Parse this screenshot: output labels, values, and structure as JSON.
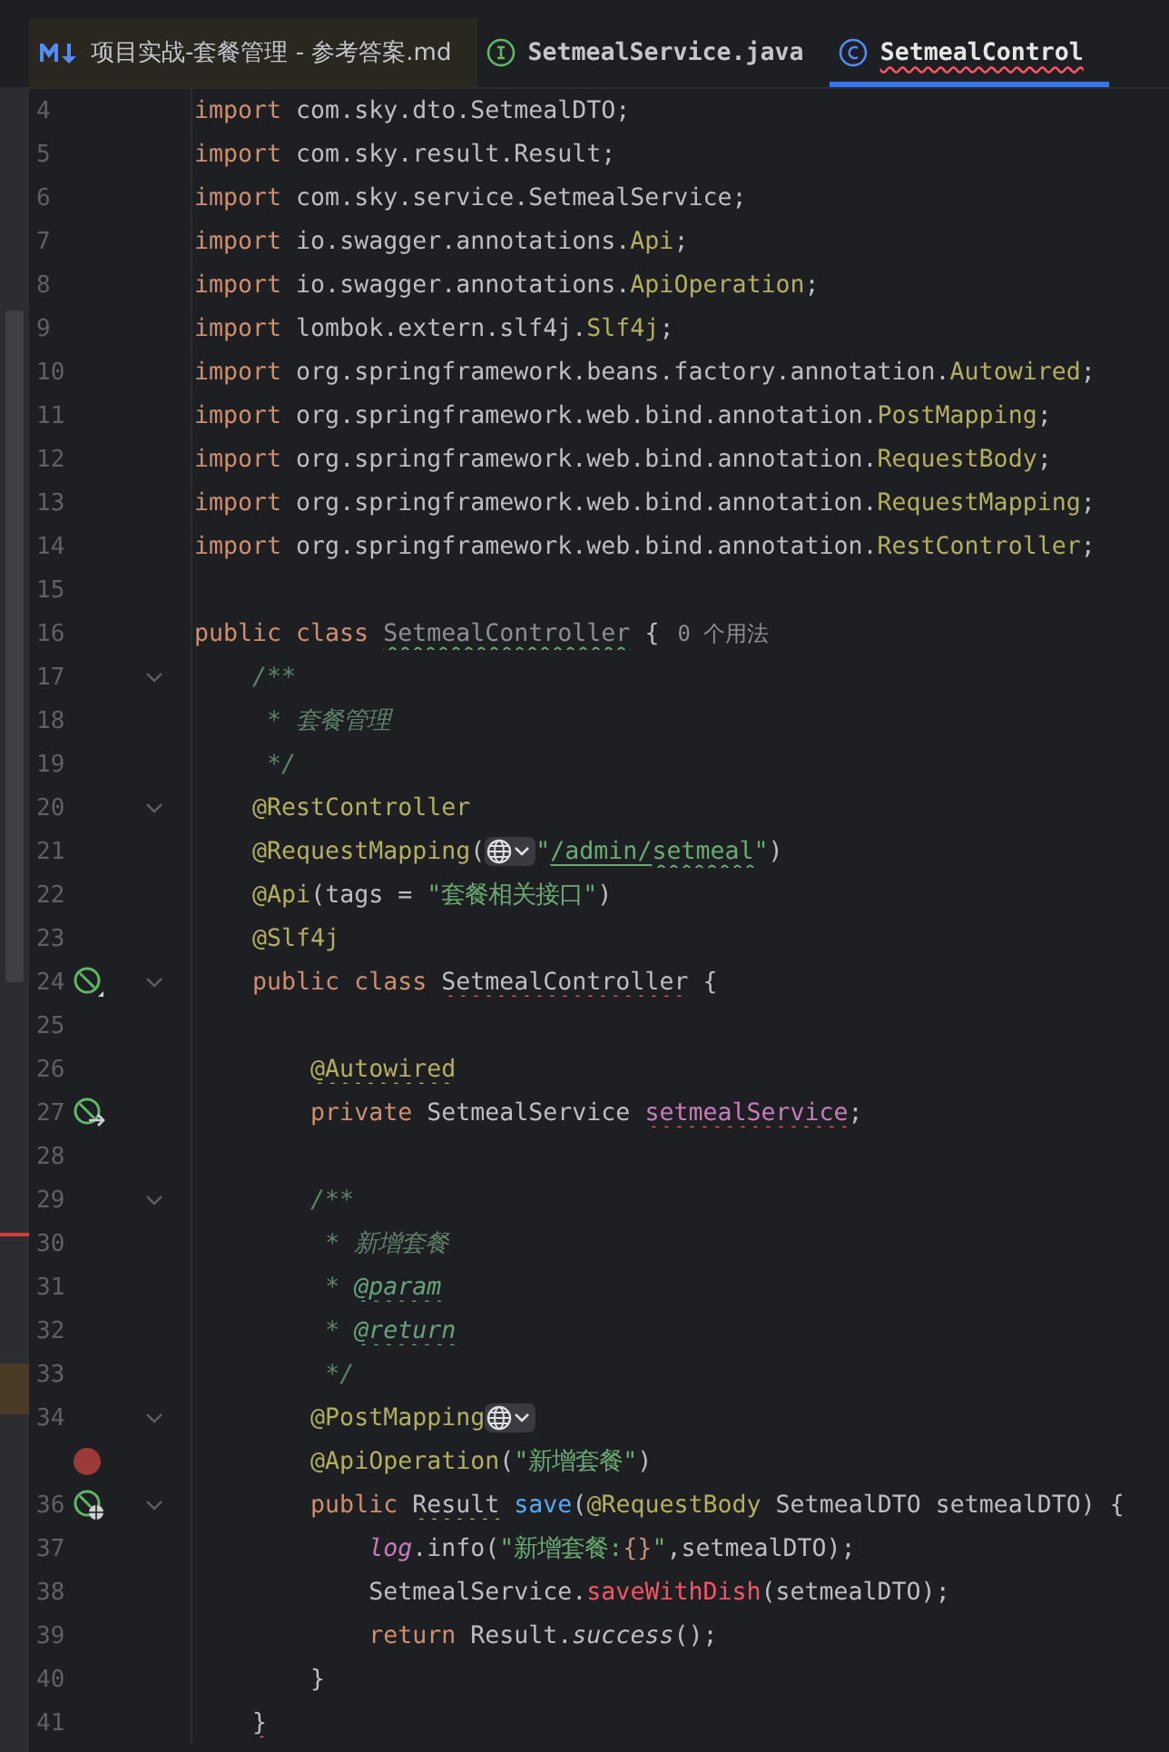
{
  "tabs": [
    {
      "kind": "markdown",
      "label": "项目实战-套餐管理 - 参考答案.md",
      "selected": false,
      "errors": false
    },
    {
      "kind": "interface",
      "label": "SetmealService.java",
      "selected": false,
      "errors": false
    },
    {
      "kind": "class",
      "label": "SetmealControl",
      "selected": true,
      "errors": true
    }
  ],
  "lines": [
    {
      "number": "4",
      "fold": false,
      "segments": [
        {
          "kind": "code",
          "tokens": [
            {
              "t": "import ",
              "kind": "keyword"
            },
            {
              "t": "com.sky.dto.SetmealDTO;",
              "kind": "text"
            }
          ]
        }
      ]
    },
    {
      "number": "5",
      "fold": false,
      "segments": [
        {
          "kind": "code",
          "tokens": [
            {
              "t": "import ",
              "kind": "keyword"
            },
            {
              "t": "com.sky.result.Result;",
              "kind": "text"
            }
          ]
        }
      ]
    },
    {
      "number": "6",
      "fold": false,
      "segments": [
        {
          "kind": "code",
          "tokens": [
            {
              "t": "import ",
              "kind": "keyword"
            },
            {
              "t": "com.sky.service.SetmealService;",
              "kind": "text"
            }
          ]
        }
      ]
    },
    {
      "number": "7",
      "fold": false,
      "segments": [
        {
          "kind": "code",
          "tokens": [
            {
              "t": "import ",
              "kind": "keyword"
            },
            {
              "t": "io.swagger.annotations.",
              "kind": "text"
            },
            {
              "t": "Api",
              "kind": "annotation"
            },
            {
              "t": ";",
              "kind": "text"
            }
          ]
        }
      ]
    },
    {
      "number": "8",
      "fold": false,
      "segments": [
        {
          "kind": "code",
          "tokens": [
            {
              "t": "import ",
              "kind": "keyword"
            },
            {
              "t": "io.swagger.annotations.",
              "kind": "text"
            },
            {
              "t": "ApiOperation",
              "kind": "annotation"
            },
            {
              "t": ";",
              "kind": "text"
            }
          ]
        }
      ]
    },
    {
      "number": "9",
      "fold": false,
      "segments": [
        {
          "kind": "code",
          "tokens": [
            {
              "t": "import ",
              "kind": "keyword"
            },
            {
              "t": "lombok.extern.slf4j.",
              "kind": "text"
            },
            {
              "t": "Slf4j",
              "kind": "annotation"
            },
            {
              "t": ";",
              "kind": "text"
            }
          ]
        }
      ]
    },
    {
      "number": "10",
      "fold": false,
      "segments": [
        {
          "kind": "code",
          "tokens": [
            {
              "t": "import ",
              "kind": "keyword"
            },
            {
              "t": "org.springframework.beans.factory.annotation.",
              "kind": "text"
            },
            {
              "t": "Autowired",
              "kind": "annotation"
            },
            {
              "t": ";",
              "kind": "text"
            }
          ]
        }
      ]
    },
    {
      "number": "11",
      "fold": false,
      "segments": [
        {
          "kind": "code",
          "tokens": [
            {
              "t": "import ",
              "kind": "keyword"
            },
            {
              "t": "org.springframework.web.bind.annotation.",
              "kind": "text"
            },
            {
              "t": "PostMapping",
              "kind": "annotation"
            },
            {
              "t": ";",
              "kind": "text"
            }
          ]
        }
      ]
    },
    {
      "number": "12",
      "fold": false,
      "segments": [
        {
          "kind": "code",
          "tokens": [
            {
              "t": "import ",
              "kind": "keyword"
            },
            {
              "t": "org.springframework.web.bind.annotation.",
              "kind": "text"
            },
            {
              "t": "RequestBody",
              "kind": "annotation"
            },
            {
              "t": ";",
              "kind": "text"
            }
          ]
        }
      ]
    },
    {
      "number": "13",
      "fold": false,
      "segments": [
        {
          "kind": "code",
          "tokens": [
            {
              "t": "import ",
              "kind": "keyword"
            },
            {
              "t": "org.springframework.web.bind.annotation.",
              "kind": "text"
            },
            {
              "t": "RequestMapping",
              "kind": "annotation"
            },
            {
              "t": ";",
              "kind": "text"
            }
          ]
        }
      ]
    },
    {
      "number": "14",
      "fold": false,
      "segments": [
        {
          "kind": "code",
          "tokens": [
            {
              "t": "import ",
              "kind": "keyword"
            },
            {
              "t": "org.springframework.web.bind.annotation.",
              "kind": "text"
            },
            {
              "t": "RestController",
              "kind": "annotation"
            },
            {
              "t": ";",
              "kind": "text"
            }
          ]
        }
      ]
    },
    {
      "number": "15",
      "fold": false
    },
    {
      "number": "16",
      "fold": false,
      "segments": [
        {
          "kind": "code",
          "tokens": [
            {
              "t": "public class ",
              "kind": "keyword"
            },
            {
              "t": "SetmealController",
              "kind": "unused"
            },
            {
              "t": " {",
              "kind": "text"
            }
          ]
        },
        {
          "kind": "hint",
          "text": "0 个用法"
        }
      ]
    },
    {
      "number": "17",
      "fold": true,
      "segments": [
        {
          "kind": "code",
          "tokens": [
            {
              "t": "    /**",
              "kind": "doc"
            }
          ]
        }
      ]
    },
    {
      "number": "18",
      "fold": false,
      "segments": [
        {
          "kind": "code",
          "tokens": [
            {
              "t": "     * 套餐管理",
              "kind": "doc"
            }
          ]
        }
      ]
    },
    {
      "number": "19",
      "fold": false,
      "segments": [
        {
          "kind": "code",
          "tokens": [
            {
              "t": "     */",
              "kind": "doc"
            }
          ]
        }
      ]
    },
    {
      "number": "20",
      "fold": true,
      "segments": [
        {
          "kind": "code",
          "tokens": [
            {
              "t": "    @RestController",
              "kind": "annotation"
            }
          ]
        }
      ]
    },
    {
      "number": "21",
      "fold": false,
      "segments": [
        {
          "kind": "code",
          "tokens": [
            {
              "t": "    @RequestMapping",
              "kind": "annotation"
            },
            {
              "t": "(",
              "kind": "text"
            }
          ]
        },
        {
          "kind": "globe"
        },
        {
          "kind": "code",
          "tokens": [
            {
              "t": "\"",
              "kind": "string"
            },
            {
              "t": "/admin/",
              "kind": "link"
            },
            {
              "t": "setmeal",
              "kind": "typo"
            },
            {
              "t": "\"",
              "kind": "string"
            },
            {
              "t": ")",
              "kind": "text"
            }
          ]
        }
      ]
    },
    {
      "number": "22",
      "fold": false,
      "segments": [
        {
          "kind": "code",
          "tokens": [
            {
              "t": "    @Api",
              "kind": "annotation"
            },
            {
              "t": "(tags = ",
              "kind": "text"
            },
            {
              "t": "\"套餐相关接口\"",
              "kind": "string"
            },
            {
              "t": ")",
              "kind": "text"
            }
          ]
        }
      ]
    },
    {
      "number": "23",
      "fold": false,
      "segments": [
        {
          "kind": "code",
          "tokens": [
            {
              "t": "    @Slf4j",
              "kind": "annotation"
            }
          ]
        }
      ]
    },
    {
      "number": "24",
      "gutter": {
        "kind": "bean"
      },
      "fold": true,
      "segments": [
        {
          "kind": "code",
          "tokens": [
            {
              "t": "    public class ",
              "kind": "keyword"
            },
            {
              "t": "SetmealController",
              "kind": "problem"
            },
            {
              "t": " {",
              "kind": "text"
            }
          ]
        }
      ]
    },
    {
      "number": "25",
      "fold": false
    },
    {
      "number": "26",
      "fold": false,
      "segments": [
        {
          "kind": "code",
          "tokens": [
            {
              "t": "        @Autowired",
              "kind": "warnannotation"
            }
          ]
        }
      ]
    },
    {
      "number": "27",
      "gutter": {
        "kind": "inject"
      },
      "fold": false,
      "segments": [
        {
          "kind": "code",
          "tokens": [
            {
              "t": "        private ",
              "kind": "keyword"
            },
            {
              "t": "SetmealService ",
              "kind": "text"
            },
            {
              "t": "setmealService",
              "kind": "badfield"
            },
            {
              "t": ";",
              "kind": "text"
            }
          ]
        }
      ]
    },
    {
      "number": "28",
      "fold": false
    },
    {
      "number": "29",
      "fold": true,
      "segments": [
        {
          "kind": "code",
          "tokens": [
            {
              "t": "        /**",
              "kind": "doc"
            }
          ]
        }
      ]
    },
    {
      "number": "30",
      "fold": false,
      "segments": [
        {
          "kind": "code",
          "tokens": [
            {
              "t": "         * 新增套餐",
              "kind": "doc"
            }
          ]
        }
      ]
    },
    {
      "number": "31",
      "fold": false,
      "segments": [
        {
          "kind": "code",
          "tokens": [
            {
              "t": "         * ",
              "kind": "doc"
            },
            {
              "t": "@param",
              "kind": "doctag"
            }
          ]
        }
      ]
    },
    {
      "number": "32",
      "fold": false,
      "segments": [
        {
          "kind": "code",
          "tokens": [
            {
              "t": "         * ",
              "kind": "doc"
            },
            {
              "t": "@return",
              "kind": "doctag"
            }
          ]
        }
      ]
    },
    {
      "number": "33",
      "fold": false,
      "segments": [
        {
          "kind": "code",
          "tokens": [
            {
              "t": "         */",
              "kind": "doc"
            }
          ]
        }
      ]
    },
    {
      "number": "34",
      "fold": true,
      "segments": [
        {
          "kind": "code",
          "tokens": [
            {
              "t": "        @PostMapping",
              "kind": "annotation"
            }
          ]
        },
        {
          "kind": "globe"
        }
      ]
    },
    {
      "gutter": {
        "kind": "breakpoint"
      },
      "fold": false,
      "segments": [
        {
          "kind": "code",
          "tokens": [
            {
              "t": "        @ApiOperation",
              "kind": "annotation"
            },
            {
              "t": "(",
              "kind": "text"
            },
            {
              "t": "\"新增套餐\"",
              "kind": "string"
            },
            {
              "t": ")",
              "kind": "text"
            }
          ]
        }
      ]
    },
    {
      "number": "36",
      "gutter": {
        "kind": "endpoint"
      },
      "fold": true,
      "segments": [
        {
          "kind": "code",
          "tokens": [
            {
              "t": "        public ",
              "kind": "keyword"
            },
            {
              "t": "Result",
              "kind": "warntext"
            },
            {
              "t": " save",
              "kind": "method"
            },
            {
              "t": "(",
              "kind": "text"
            },
            {
              "t": "@RequestBody",
              "kind": "annotation"
            },
            {
              "t": " SetmealDTO setmealDTO) {",
              "kind": "text"
            }
          ]
        }
      ]
    },
    {
      "number": "37",
      "fold": false,
      "segments": [
        {
          "kind": "code",
          "tokens": [
            {
              "t": "            log",
              "kind": "logfield"
            },
            {
              "t": ".info(",
              "kind": "text"
            },
            {
              "t": "\"新增套餐:",
              "kind": "string"
            },
            {
              "t": "{}",
              "kind": "escape"
            },
            {
              "t": "\"",
              "kind": "string"
            },
            {
              "t": ",setmealDTO);",
              "kind": "text"
            }
          ]
        }
      ]
    },
    {
      "number": "38",
      "fold": false,
      "segments": [
        {
          "kind": "code",
          "tokens": [
            {
              "t": "            SetmealService.",
              "kind": "text"
            },
            {
              "t": "saveWithDish",
              "kind": "error"
            },
            {
              "t": "(setmealDTO);",
              "kind": "text"
            }
          ]
        }
      ]
    },
    {
      "number": "39",
      "fold": false,
      "segments": [
        {
          "kind": "code",
          "tokens": [
            {
              "t": "            return ",
              "kind": "keyword"
            },
            {
              "t": "Result.",
              "kind": "text"
            },
            {
              "t": "success",
              "kind": "static"
            },
            {
              "t": "();",
              "kind": "text"
            }
          ]
        }
      ]
    },
    {
      "number": "40",
      "fold": false,
      "segments": [
        {
          "kind": "code",
          "tokens": [
            {
              "t": "        }",
              "kind": "text"
            }
          ]
        }
      ]
    },
    {
      "number": "41",
      "fold": false,
      "segments": [
        {
          "kind": "code",
          "tokens": [
            {
              "t": "    }",
              "kind": "problemtext"
            }
          ]
        }
      ]
    }
  ]
}
